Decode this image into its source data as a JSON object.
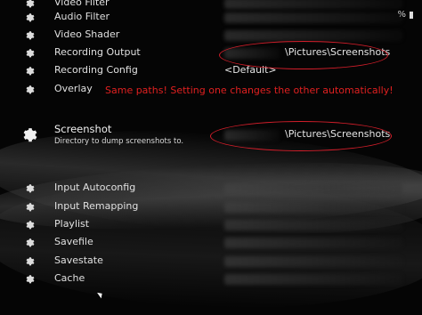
{
  "menu": {
    "items_top": [
      {
        "label": "Video Filter"
      },
      {
        "label": "Audio Filter"
      },
      {
        "label": "Video Shader"
      },
      {
        "label": "Recording Output",
        "value_suffix": "\\Pictures\\Screenshots"
      },
      {
        "label": "Recording Config",
        "value": "<Default>"
      },
      {
        "label": "Overlay"
      }
    ],
    "screenshot": {
      "label": "Screenshot",
      "sublabel": "Directory to dump screenshots to.",
      "value_suffix": "\\Pictures\\Screenshots"
    },
    "items_bottom": [
      {
        "label": "Input Autoconfig"
      },
      {
        "label": "Input Remapping"
      },
      {
        "label": "Playlist"
      },
      {
        "label": "Savefile"
      },
      {
        "label": "Savestate"
      },
      {
        "label": "Cache"
      }
    ]
  },
  "annotation": {
    "text": "Same paths! Setting one changes the other automatically!",
    "color": "#e02020"
  },
  "status": {
    "battery_text": "%"
  },
  "colors": {
    "background": "#050505",
    "highlight": "#d21e2a"
  },
  "icons": {
    "setting": "gear-icon"
  }
}
